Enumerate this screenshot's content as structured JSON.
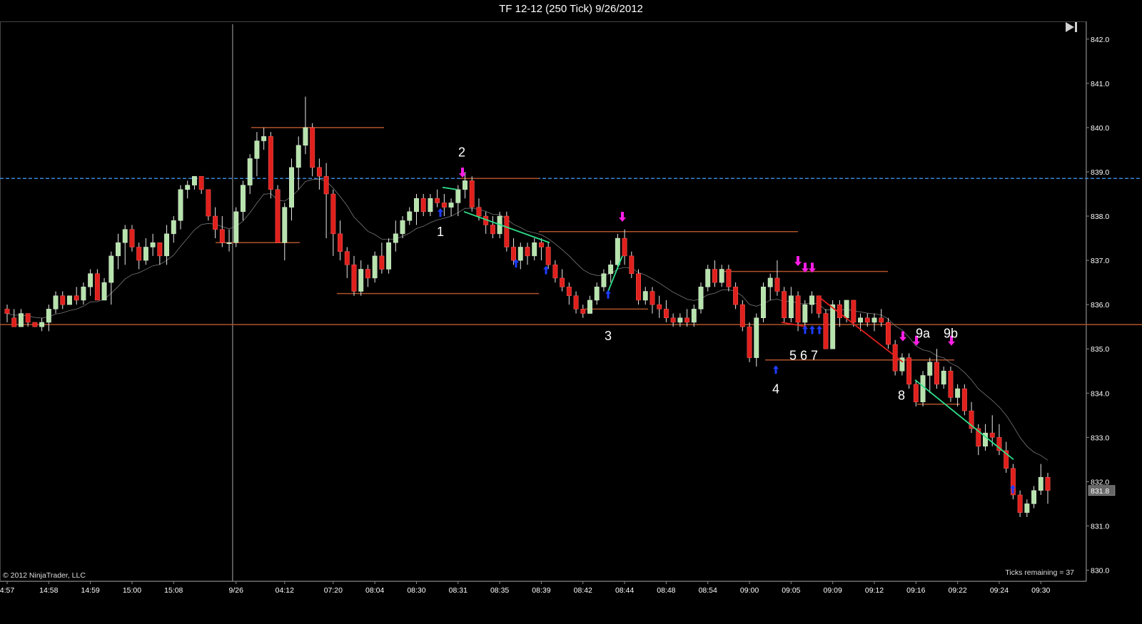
{
  "window": {
    "title": "TF 12-12 (250 Tick)  9/26/2012"
  },
  "copyright": "© 2012 NinjaTrader, LLC",
  "ticks_remaining": "Ticks remaining = 37",
  "price_marker": "831.8",
  "colors": {
    "background": "#000000",
    "up_candle": "#b7e3ad",
    "down_candle": "#e0201c",
    "level_line": "#b0522a",
    "hline_dashed": "#3a86d6",
    "trend_green": "#2fe08a",
    "trend_red": "#e0201c",
    "arrow_up": "#1e3cff",
    "arrow_down": "#ff1ee6",
    "ema": "#777777"
  },
  "chart_data": {
    "type": "candlestick",
    "title": "TF 12-12 (250 Tick)  9/26/2012",
    "ylim": [
      829.75,
      842.4
    ],
    "y_ticks": [
      830.0,
      831.0,
      832.0,
      833.0,
      834.0,
      835.0,
      836.0,
      837.0,
      838.0,
      839.0,
      840.0,
      841.0,
      842.0
    ],
    "y_tick_labels": [
      "830.0",
      "831.0",
      "832.0",
      "833.0",
      "834.0",
      "835.0",
      "836.0",
      "837.0",
      "838.0",
      "839.0",
      "840.0",
      "841.0",
      "842.0"
    ],
    "x_tick_labels": [
      "4:57",
      "14:58",
      "14:59",
      "15:00",
      "15:08",
      "9/26",
      "04:12",
      "07:20",
      "08:04",
      "08:30",
      "08:31",
      "08:35",
      "08:39",
      "08:42",
      "08:44",
      "08:48",
      "08:54",
      "09:00",
      "09:05",
      "09:09",
      "09:12",
      "09:16",
      "09:22",
      "09:24",
      "09:30"
    ],
    "x_tick_bar_index": [
      0,
      6,
      12,
      18,
      24,
      33,
      40,
      47,
      53,
      59,
      65,
      71,
      77,
      83,
      89,
      95,
      101,
      107,
      113,
      119,
      125,
      131,
      137,
      143,
      149
    ],
    "session_break_bar": 32.5,
    "dashed_level": 838.85,
    "last_price": 831.8,
    "candles": [
      [
        835.9,
        836.0,
        835.6,
        835.8
      ],
      [
        835.7,
        835.9,
        835.5,
        835.5
      ],
      [
        835.5,
        835.9,
        835.5,
        835.8
      ],
      [
        835.8,
        835.8,
        835.5,
        835.6
      ],
      [
        835.6,
        835.6,
        835.5,
        835.5
      ],
      [
        835.5,
        835.7,
        835.4,
        835.6
      ],
      [
        835.6,
        836.0,
        835.4,
        835.9
      ],
      [
        835.9,
        836.3,
        835.8,
        836.2
      ],
      [
        836.2,
        836.3,
        835.9,
        836.0
      ],
      [
        836.0,
        836.2,
        836.0,
        836.2
      ],
      [
        836.2,
        836.4,
        836.0,
        836.1
      ],
      [
        836.1,
        836.5,
        836.0,
        836.4
      ],
      [
        836.4,
        836.8,
        836.2,
        836.7
      ],
      [
        836.7,
        836.8,
        836.1,
        836.1
      ],
      [
        836.1,
        836.6,
        836.1,
        836.5
      ],
      [
        836.5,
        837.2,
        836.0,
        837.1
      ],
      [
        837.1,
        837.6,
        836.8,
        837.4
      ],
      [
        837.4,
        837.8,
        836.9,
        837.7
      ],
      [
        837.7,
        837.8,
        837.2,
        837.3
      ],
      [
        837.3,
        837.4,
        836.8,
        837.0
      ],
      [
        837.0,
        837.5,
        836.9,
        837.3
      ],
      [
        837.3,
        837.6,
        837.1,
        837.4
      ],
      [
        837.4,
        837.4,
        836.9,
        837.1
      ],
      [
        837.1,
        837.8,
        836.9,
        837.6
      ],
      [
        837.6,
        838.0,
        837.4,
        837.9
      ],
      [
        837.9,
        838.7,
        837.7,
        838.6
      ],
      [
        838.6,
        838.8,
        838.4,
        838.7
      ],
      [
        838.7,
        838.9,
        838.6,
        838.9
      ],
      [
        838.9,
        838.9,
        838.5,
        838.6
      ],
      [
        838.6,
        838.6,
        837.9,
        838.0
      ],
      [
        838.0,
        838.2,
        837.5,
        837.7
      ],
      [
        837.7,
        838.0,
        837.3,
        837.4
      ],
      [
        837.4,
        837.7,
        837.2,
        837.4
      ],
      [
        837.4,
        838.2,
        837.3,
        838.1
      ],
      [
        838.1,
        838.8,
        837.9,
        838.7
      ],
      [
        838.7,
        839.4,
        838.5,
        839.3
      ],
      [
        839.3,
        839.9,
        838.9,
        839.7
      ],
      [
        839.7,
        840.0,
        839.5,
        839.8
      ],
      [
        839.8,
        839.9,
        838.4,
        838.6
      ],
      [
        838.6,
        838.7,
        837.4,
        837.4
      ],
      [
        837.4,
        838.3,
        837.0,
        838.2
      ],
      [
        838.2,
        839.3,
        837.9,
        839.1
      ],
      [
        839.1,
        839.8,
        838.6,
        839.6
      ],
      [
        839.6,
        840.7,
        839.4,
        840.0
      ],
      [
        840.0,
        840.1,
        838.9,
        839.1
      ],
      [
        839.1,
        839.3,
        838.6,
        838.9
      ],
      [
        838.9,
        839.2,
        837.5,
        838.5
      ],
      [
        838.5,
        838.6,
        837.1,
        837.6
      ],
      [
        837.6,
        837.9,
        837.0,
        837.2
      ],
      [
        837.2,
        837.3,
        836.6,
        836.9
      ],
      [
        836.9,
        837.1,
        836.2,
        836.3
      ],
      [
        836.3,
        837.0,
        836.2,
        836.8
      ],
      [
        836.8,
        836.9,
        836.4,
        836.6
      ],
      [
        836.6,
        837.2,
        836.5,
        837.1
      ],
      [
        837.1,
        837.4,
        836.7,
        836.8
      ],
      [
        836.8,
        837.5,
        836.7,
        837.4
      ],
      [
        837.4,
        837.9,
        837.2,
        837.6
      ],
      [
        837.6,
        838.0,
        837.5,
        837.9
      ],
      [
        837.9,
        838.2,
        837.8,
        838.1
      ],
      [
        838.1,
        838.5,
        837.8,
        838.4
      ],
      [
        838.4,
        838.5,
        838.0,
        838.1
      ],
      [
        838.1,
        838.5,
        838.0,
        838.4
      ],
      [
        838.4,
        838.6,
        838.2,
        838.3
      ],
      [
        838.3,
        838.5,
        838.0,
        838.2
      ],
      [
        838.2,
        838.4,
        838.0,
        838.3
      ],
      [
        838.3,
        838.7,
        838.0,
        838.6
      ],
      [
        838.6,
        839.0,
        838.4,
        838.8
      ],
      [
        838.8,
        838.9,
        838.1,
        838.2
      ],
      [
        838.2,
        838.4,
        837.9,
        838.0
      ],
      [
        838.0,
        838.1,
        837.6,
        837.8
      ],
      [
        837.8,
        838.0,
        837.5,
        837.6
      ],
      [
        837.6,
        838.1,
        837.5,
        838.0
      ],
      [
        838.0,
        838.1,
        837.2,
        837.3
      ],
      [
        837.3,
        837.5,
        836.9,
        837.0
      ],
      [
        837.0,
        837.4,
        836.8,
        837.3
      ],
      [
        837.3,
        837.4,
        836.9,
        837.1
      ],
      [
        837.1,
        837.5,
        837.0,
        837.4
      ],
      [
        837.4,
        837.5,
        837.0,
        837.3
      ],
      [
        837.3,
        837.4,
        836.8,
        836.9
      ],
      [
        836.9,
        837.0,
        836.5,
        836.6
      ],
      [
        836.6,
        836.8,
        836.3,
        836.4
      ],
      [
        836.4,
        836.5,
        836.0,
        836.2
      ],
      [
        836.2,
        836.3,
        835.8,
        835.9
      ],
      [
        835.9,
        836.0,
        835.7,
        835.8
      ],
      [
        835.8,
        836.2,
        835.8,
        836.1
      ],
      [
        836.1,
        836.5,
        836.0,
        836.4
      ],
      [
        836.4,
        836.8,
        836.3,
        836.7
      ],
      [
        836.7,
        837.0,
        836.5,
        836.9
      ],
      [
        836.9,
        837.6,
        836.8,
        837.5
      ],
      [
        837.5,
        837.7,
        836.9,
        837.1
      ],
      [
        837.1,
        837.2,
        836.6,
        836.7
      ],
      [
        836.7,
        836.8,
        836.0,
        836.1
      ],
      [
        836.1,
        836.4,
        836.0,
        836.3
      ],
      [
        836.3,
        836.4,
        835.8,
        836.0
      ],
      [
        836.0,
        836.2,
        835.7,
        835.9
      ],
      [
        835.9,
        836.1,
        835.6,
        835.7
      ],
      [
        835.7,
        835.8,
        835.5,
        835.6
      ],
      [
        835.6,
        835.8,
        835.5,
        835.7
      ],
      [
        835.7,
        835.9,
        835.5,
        835.6
      ],
      [
        835.6,
        836.0,
        835.5,
        835.9
      ],
      [
        835.9,
        836.5,
        835.8,
        836.4
      ],
      [
        836.4,
        836.9,
        836.3,
        836.8
      ],
      [
        836.8,
        837.0,
        836.4,
        836.5
      ],
      [
        836.5,
        836.9,
        836.4,
        836.8
      ],
      [
        836.8,
        836.9,
        836.3,
        836.4
      ],
      [
        836.4,
        836.5,
        835.9,
        836.0
      ],
      [
        836.0,
        836.1,
        835.4,
        835.5
      ],
      [
        835.5,
        835.6,
        834.7,
        834.8
      ],
      [
        834.8,
        835.8,
        834.6,
        835.7
      ],
      [
        835.7,
        836.5,
        835.6,
        836.4
      ],
      [
        836.4,
        836.7,
        836.1,
        836.6
      ],
      [
        836.6,
        837.0,
        836.2,
        836.3
      ],
      [
        836.3,
        836.4,
        835.6,
        835.7
      ],
      [
        835.7,
        836.4,
        835.6,
        836.2
      ],
      [
        836.2,
        836.3,
        835.4,
        835.6
      ],
      [
        835.6,
        836.1,
        835.5,
        836.0
      ],
      [
        836.0,
        836.3,
        835.8,
        836.2
      ],
      [
        836.2,
        836.2,
        835.7,
        835.8
      ],
      [
        835.8,
        835.9,
        835.0,
        835.0
      ],
      [
        835.0,
        836.1,
        835.0,
        836.0
      ],
      [
        836.0,
        836.1,
        835.5,
        835.7
      ],
      [
        835.7,
        836.1,
        835.6,
        836.1
      ],
      [
        836.1,
        836.1,
        835.5,
        835.6
      ],
      [
        835.6,
        835.8,
        835.4,
        835.7
      ],
      [
        835.7,
        835.8,
        835.5,
        835.6
      ],
      [
        835.6,
        835.8,
        835.4,
        835.7
      ],
      [
        835.7,
        835.9,
        835.5,
        835.6
      ],
      [
        835.6,
        835.7,
        835.0,
        835.1
      ],
      [
        835.1,
        835.2,
        834.4,
        834.5
      ],
      [
        834.5,
        834.9,
        834.4,
        834.8
      ],
      [
        834.8,
        834.9,
        834.1,
        834.2
      ],
      [
        834.2,
        834.3,
        833.7,
        833.8
      ],
      [
        833.8,
        834.5,
        833.7,
        834.4
      ],
      [
        834.4,
        834.8,
        834.0,
        834.7
      ],
      [
        834.7,
        835.0,
        834.1,
        834.2
      ],
      [
        834.2,
        834.6,
        834.1,
        834.5
      ],
      [
        834.5,
        834.6,
        833.8,
        833.9
      ],
      [
        833.9,
        834.2,
        833.7,
        834.1
      ],
      [
        834.1,
        834.2,
        833.5,
        833.6
      ],
      [
        833.6,
        833.8,
        833.1,
        833.2
      ],
      [
        833.2,
        833.3,
        832.6,
        832.8
      ],
      [
        832.8,
        833.3,
        832.7,
        833.1
      ],
      [
        833.1,
        833.5,
        832.8,
        833.0
      ],
      [
        833.0,
        833.3,
        832.6,
        832.7
      ],
      [
        832.7,
        832.9,
        832.2,
        832.3
      ],
      [
        832.3,
        832.4,
        831.6,
        831.7
      ],
      [
        831.7,
        831.8,
        831.2,
        831.3
      ],
      [
        831.3,
        831.6,
        831.2,
        831.5
      ],
      [
        831.5,
        831.9,
        831.4,
        831.8
      ],
      [
        831.8,
        832.4,
        831.7,
        832.1
      ],
      [
        832.1,
        832.2,
        831.5,
        831.8
      ]
    ],
    "levels": [
      {
        "from": 0,
        "to": 1600,
        "price": 835.55,
        "x_mode": "px"
      },
      {
        "from": 302,
        "to": 420,
        "price": 837.4,
        "x_mode": "px"
      },
      {
        "from": 352,
        "to": 538,
        "price": 840.0,
        "x_mode": "px"
      },
      {
        "from": 472,
        "to": 755,
        "price": 836.25,
        "x_mode": "px"
      },
      {
        "from": 645,
        "to": 755,
        "price": 838.85,
        "x_mode": "px"
      },
      {
        "from": 755,
        "to": 1118,
        "price": 837.65,
        "x_mode": "px"
      },
      {
        "from": 820,
        "to": 908,
        "price": 835.9,
        "x_mode": "px"
      },
      {
        "from": 1010,
        "to": 1244,
        "price": 836.75,
        "x_mode": "px"
      },
      {
        "from": 1072,
        "to": 1337,
        "price": 834.75,
        "x_mode": "px"
      },
      {
        "from": 1285,
        "to": 1345,
        "price": 833.75,
        "x_mode": "px"
      }
    ],
    "trend_lines": [
      {
        "color": "green",
        "points": [
          [
            650,
            838.1
          ],
          [
            770,
            837.4
          ]
        ]
      },
      {
        "color": "green",
        "points": [
          [
            620,
            838.65
          ],
          [
            640,
            838.6
          ]
        ]
      },
      {
        "color": "green",
        "points": [
          [
            852,
            836.3
          ],
          [
            872,
            837.1
          ]
        ]
      },
      {
        "color": "green",
        "points": [
          [
            1282,
            834.3
          ],
          [
            1420,
            832.5
          ]
        ]
      },
      {
        "color": "red",
        "points": [
          [
            1145,
            836.2
          ],
          [
            1265,
            834.7
          ]
        ]
      },
      {
        "color": "red",
        "points": [
          [
            1095,
            835.6
          ],
          [
            1130,
            835.5
          ]
        ]
      }
    ],
    "annotations": [
      {
        "text": "1",
        "x": 617,
        "price": 837.55
      },
      {
        "text": "2",
        "x": 647,
        "price": 839.35
      },
      {
        "text": "3",
        "x": 852,
        "price": 835.2
      },
      {
        "text": "4",
        "x": 1087,
        "price": 834.0
      },
      {
        "text": "5 6 7",
        "x": 1126,
        "price": 834.75
      },
      {
        "text": "8",
        "x": 1263,
        "price": 833.85
      },
      {
        "text": "9a",
        "x": 1293,
        "price": 835.25
      },
      {
        "text": "9b",
        "x": 1332,
        "price": 835.25
      }
    ],
    "arrows_up": [
      [
        617,
        838.05
      ],
      [
        723,
        836.9
      ],
      [
        765,
        836.75
      ],
      [
        852,
        836.2
      ],
      [
        1087,
        834.5
      ],
      [
        1128,
        835.4
      ],
      [
        1138,
        835.4
      ],
      [
        1148,
        835.4
      ],
      [
        1419,
        831.8
      ]
    ],
    "arrows_down": [
      [
        648,
        839.0
      ],
      [
        872,
        838.0
      ],
      [
        1118,
        837.0
      ],
      [
        1128,
        836.85
      ],
      [
        1138,
        836.85
      ],
      [
        1265,
        835.3
      ],
      [
        1284,
        835.2
      ],
      [
        1333,
        835.2
      ]
    ]
  }
}
